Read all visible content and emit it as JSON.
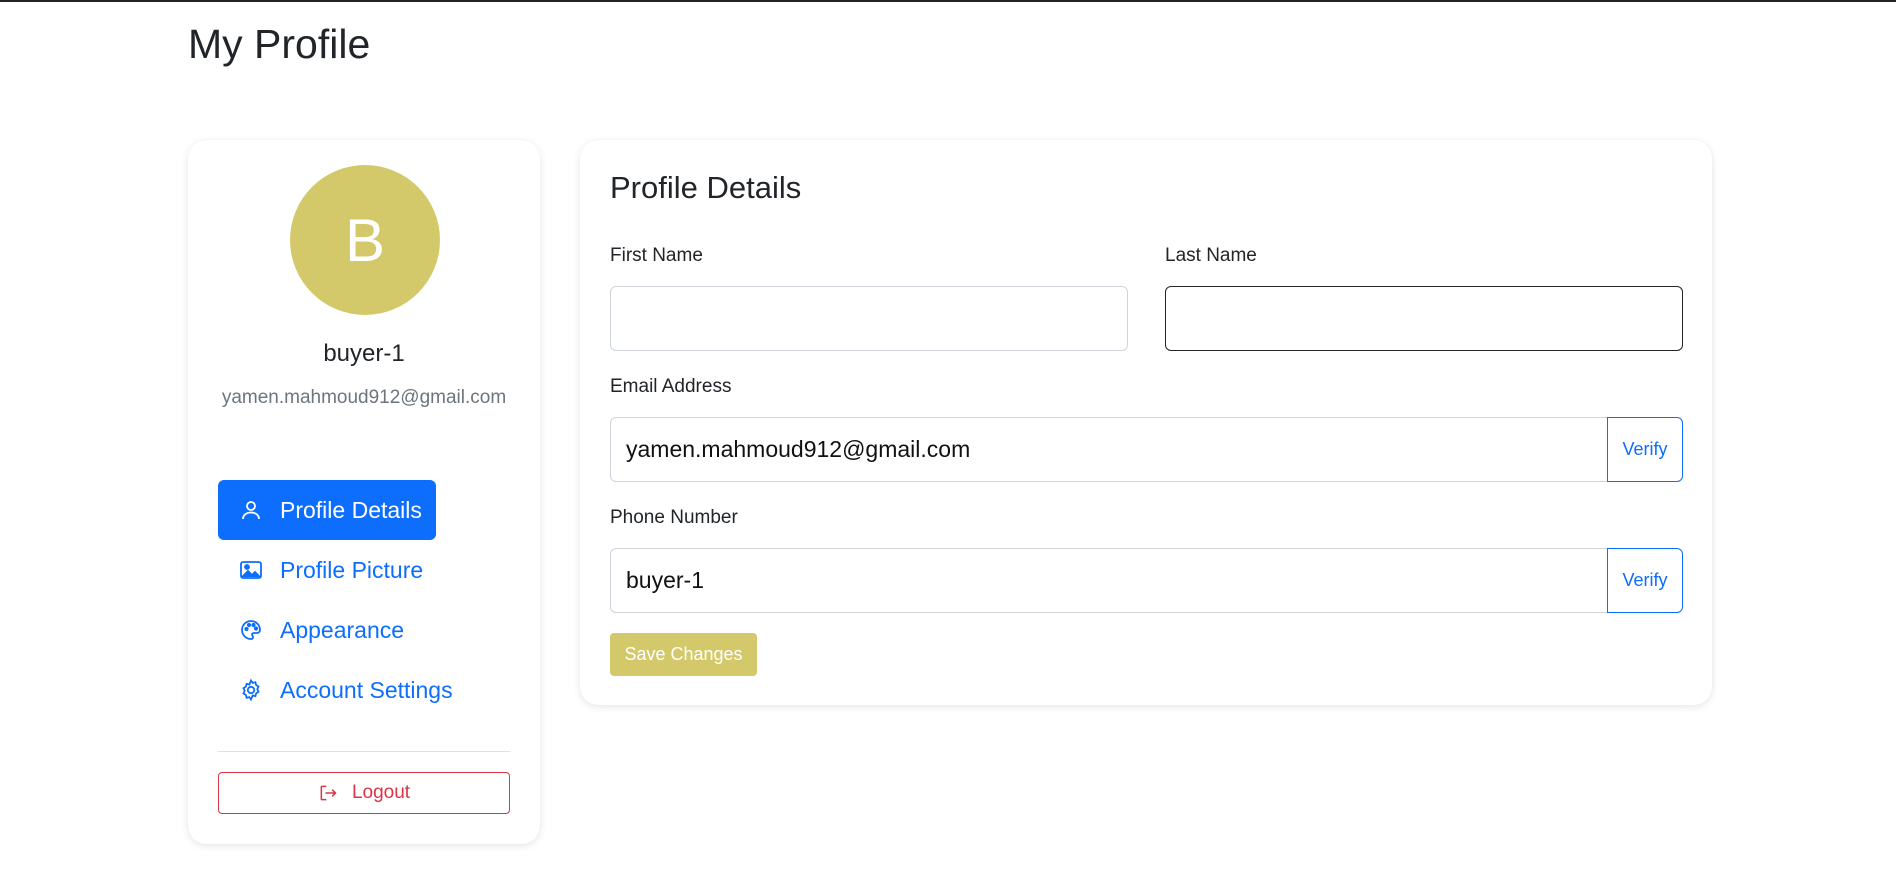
{
  "page": {
    "title": "My Profile"
  },
  "colors": {
    "accent": "#d4c96a",
    "primary": "#0d6efd",
    "danger": "#dc3545",
    "muted": "#6c757d"
  },
  "sidebar": {
    "avatar_letter": "B",
    "username": "buyer-1",
    "email": "yamen.mahmoud912@gmail.com",
    "nav": [
      {
        "label": "Profile Details",
        "icon": "person-icon",
        "active": true
      },
      {
        "label": "Profile Picture",
        "icon": "image-icon",
        "active": false
      },
      {
        "label": "Appearance",
        "icon": "palette-icon",
        "active": false
      },
      {
        "label": "Account Settings",
        "icon": "gear-icon",
        "active": false
      }
    ],
    "logout_label": "Logout",
    "logout_icon": "logout-icon"
  },
  "form": {
    "title": "Profile Details",
    "first_name": {
      "label": "First Name",
      "value": ""
    },
    "last_name": {
      "label": "Last Name",
      "value": ""
    },
    "email": {
      "label": "Email Address",
      "value": "yamen.mahmoud912@gmail.com",
      "verify_label": "Verify"
    },
    "phone": {
      "label": "Phone Number",
      "value": "buyer-1",
      "verify_label": "Verify"
    },
    "save_label": "Save Changes"
  }
}
